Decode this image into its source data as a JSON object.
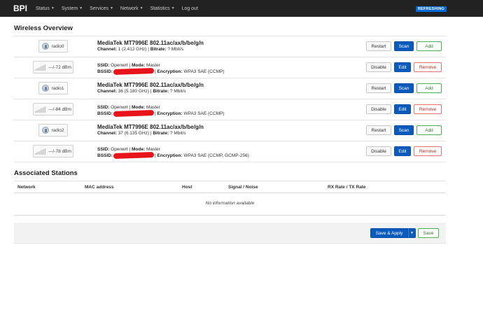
{
  "nav": {
    "brand": "BPI",
    "items": [
      "Status",
      "System",
      "Services",
      "Network",
      "Statistics",
      "Log out"
    ],
    "status_badge": "REFRESHING"
  },
  "wireless": {
    "title": "Wireless Overview",
    "radios": [
      {
        "radio_name": "radio0",
        "model": "MediaTek MT7996E 802.11ac/ax/b/be/g/n",
        "channel_label": "Channel:",
        "channel_value": " 1 (2.412 GHz) | ",
        "bitrate_label": "Bitrate:",
        "bitrate_value": " ? Mbit/s",
        "signal": "---/-72 dBm",
        "ssid_label": "SSID:",
        "ssid_value": " Openwrt | ",
        "mode_label": "Mode:",
        "mode_value": " Master",
        "bssid_label": "BSSID:",
        "encryption_label": "Encryption:",
        "encryption_value": " WPA3 SAE (CCMP)"
      },
      {
        "radio_name": "radio1",
        "model": "MediaTek MT7996E 802.11ac/ax/b/be/g/n",
        "channel_label": "Channel:",
        "channel_value": " 36 (5.180 GHz) | ",
        "bitrate_label": "Bitrate:",
        "bitrate_value": " ? Mbit/s",
        "signal": "---/-84 dBm",
        "ssid_label": "SSID:",
        "ssid_value": " Openwrt | ",
        "mode_label": "Mode:",
        "mode_value": " Master",
        "bssid_label": "BSSID:",
        "encryption_label": "Encryption:",
        "encryption_value": " WPA3 SAE (CCMP)"
      },
      {
        "radio_name": "radio2",
        "model": "MediaTek MT7996E 802.11ac/ax/b/be/g/n",
        "channel_label": "Channel:",
        "channel_value": " 37 (6.135 GHz) | ",
        "bitrate_label": "Bitrate:",
        "bitrate_value": " ? Mbit/s",
        "signal": "---/-78 dBm",
        "ssid_label": "SSID:",
        "ssid_value": " Openwrt | ",
        "mode_label": "Mode:",
        "mode_value": " Master",
        "bssid_label": "BSSID:",
        "encryption_label": "Encryption:",
        "encryption_value": " WPA3 SAE (CCMP, GCMP-256)"
      }
    ],
    "buttons": {
      "restart": "Restart",
      "scan": "Scan",
      "add": "Add",
      "disable": "Disable",
      "edit": "Edit",
      "remove": "Remove"
    }
  },
  "stations": {
    "title": "Associated Stations",
    "columns": [
      "Network",
      "MAC address",
      "Host",
      "Signal / Noise",
      "RX Rate / TX Rate"
    ],
    "empty_text": "No information available"
  },
  "footer": {
    "save_apply": "Save & Apply",
    "save": "Save"
  },
  "colors": {
    "navbar": "#222222",
    "primary": "#0b5bbf",
    "badge": "#0069d9",
    "success": "#4caf50",
    "danger": "#e57373",
    "redaction": "#e8141b"
  }
}
